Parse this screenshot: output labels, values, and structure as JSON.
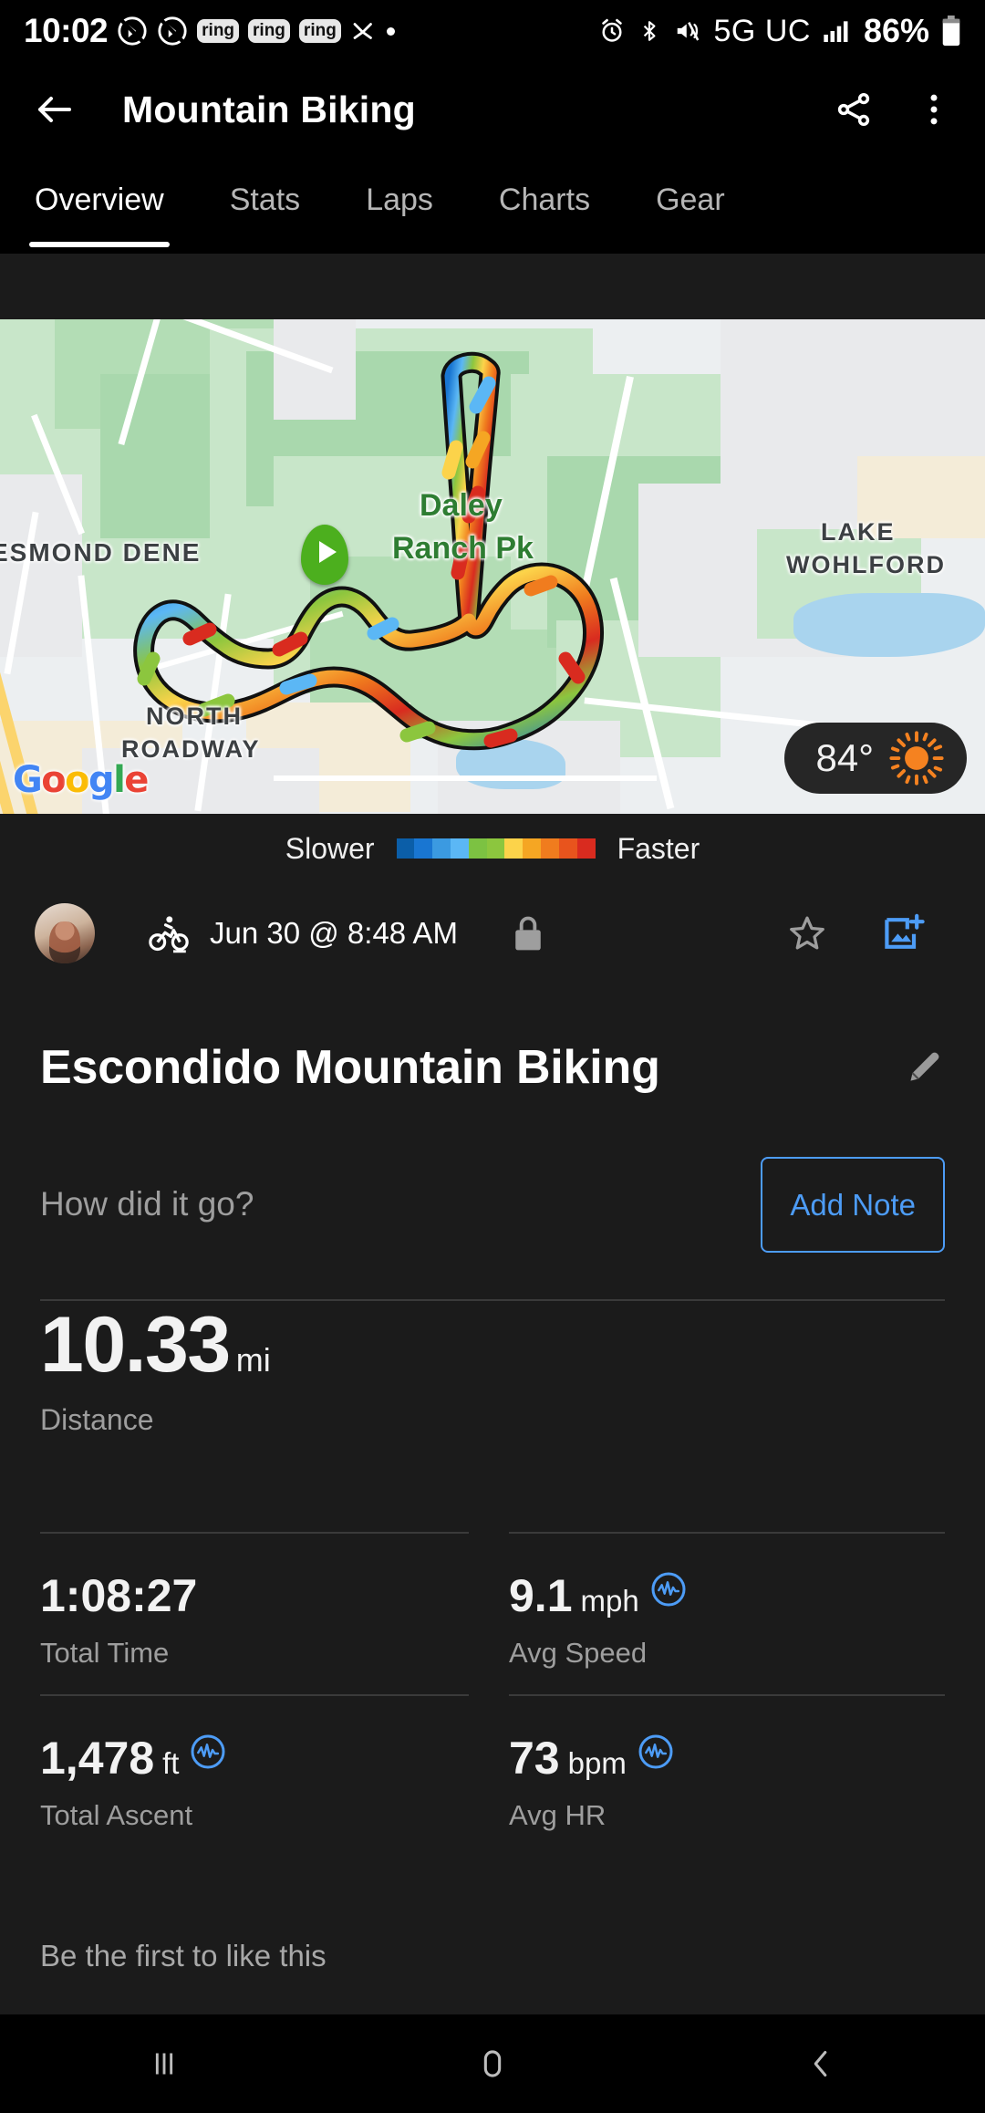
{
  "status_bar": {
    "time": "10:02",
    "ring_badges": [
      "ring",
      "ring",
      "ring"
    ],
    "network": "5G UC",
    "battery": "86%",
    "icons": [
      "do-not-disturb-icon",
      "do-not-disturb-icon",
      "ring-badge",
      "ring-badge",
      "ring-badge",
      "shuffle-icon",
      "dot-icon",
      "alarm-icon",
      "bluetooth-icon",
      "mute-vibrate-icon",
      "signal-bars-icon",
      "battery-icon"
    ]
  },
  "app_bar": {
    "back_label": "back-arrow",
    "title": "Mountain Biking",
    "share_label": "share",
    "overflow_label": "more-options"
  },
  "tabs": [
    {
      "label": "Overview",
      "active": true
    },
    {
      "label": "Stats",
      "active": false
    },
    {
      "label": "Laps",
      "active": false
    },
    {
      "label": "Charts",
      "active": false
    },
    {
      "label": "Gear",
      "active": false
    }
  ],
  "map": {
    "labels": [
      {
        "text": "Daley",
        "kind": "park"
      },
      {
        "text": "Ranch Pk",
        "kind": "park"
      },
      {
        "text": "ESMOND DENE",
        "kind": "place"
      },
      {
        "text": "LAKE",
        "kind": "place"
      },
      {
        "text": "WOHLFORD",
        "kind": "place"
      },
      {
        "text": "NORTH",
        "kind": "place"
      },
      {
        "text": "ROADWAY",
        "kind": "place"
      }
    ],
    "attribution": "Google",
    "weather": {
      "temperature": "84°",
      "condition_icon": "sun-icon"
    },
    "start_pin": "start-marker-play-icon"
  },
  "legend": {
    "left_label": "Slower",
    "right_label": "Faster",
    "colors": [
      "#0b5ea8",
      "#1976d2",
      "#3b9ae1",
      "#5bb7f5",
      "#7cc242",
      "#8cc63e",
      "#fcd34a",
      "#f5a623",
      "#f07c1e",
      "#e8541d",
      "#d92b1f"
    ]
  },
  "meta": {
    "avatar_label": "user-avatar",
    "activity_type_icon": "mountain-biking-icon",
    "date": "Jun 30 @ 8:48 AM",
    "privacy_icon": "lock-icon",
    "favorite_icon": "star-outline-icon",
    "add_photo_icon": "add-photo-icon"
  },
  "activity": {
    "title": "Escondido Mountain Biking",
    "edit_icon": "pencil-icon",
    "note_placeholder": "How did it go?",
    "add_note_label": "Add Note"
  },
  "stats": {
    "primary": {
      "value": "10.33",
      "unit": "mi",
      "label": "Distance"
    },
    "grid": [
      {
        "value": "1:08:27",
        "unit": "",
        "label": "Total Time",
        "has_chart_icon": false
      },
      {
        "value": "9.1",
        "unit": "mph",
        "label": "Avg Speed",
        "has_chart_icon": true
      },
      {
        "value": "1,478",
        "unit": "ft",
        "label": "Total Ascent",
        "has_chart_icon": true
      },
      {
        "value": "73",
        "unit": "bpm",
        "label": "Avg HR",
        "has_chart_icon": true
      }
    ]
  },
  "footer": {
    "likes_text": "Be the first to like this"
  },
  "nav_bar": {
    "recents_icon": "recents-icon",
    "home_icon": "home-icon",
    "back_icon": "back-icon"
  },
  "colors": {
    "accent_blue": "#4d9cf6",
    "background": "#1b1b1b",
    "bar_black": "#000000",
    "muted_text": "#9e9e9e",
    "weather_orange": "#f58220"
  }
}
